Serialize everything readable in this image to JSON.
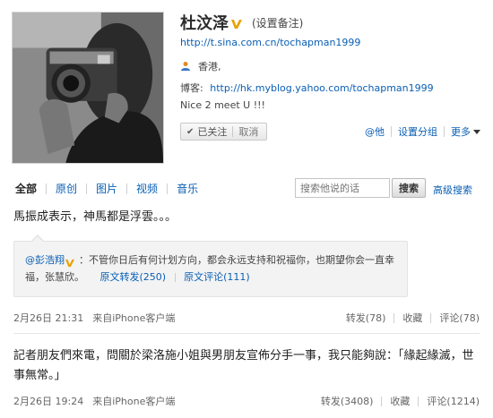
{
  "profile": {
    "name": "杜汶泽",
    "verified_icon": "verified-v-icon",
    "remark_link": "(设置备注)",
    "home_url": "http://t.sina.com.cn/tochapman1999",
    "location_icon": "person-location-icon",
    "location": "香港,",
    "blog_label": "博客:",
    "blog_url": "http://hk.myblog.yahoo.com/tochapman1999",
    "bio": "Nice 2 meet U !!!",
    "follow_status": "已关注",
    "unfollow": "取消",
    "actions": {
      "mention": "@他",
      "set_group": "设置分组",
      "more": "更多"
    }
  },
  "tabs": [
    {
      "label": "全部",
      "active": true
    },
    {
      "label": "原创",
      "active": false
    },
    {
      "label": "图片",
      "active": false
    },
    {
      "label": "视频",
      "active": false
    },
    {
      "label": "音乐",
      "active": false
    }
  ],
  "search": {
    "placeholder": "搜索他说的话",
    "button": "搜索",
    "advanced": "高级搜索"
  },
  "posts": [
    {
      "text": "馬振成表示，神馬都是浮雲。。。",
      "retweet": {
        "author": "@彭浩翔",
        "author_verified_icon": "verified-v-icon",
        "text": "：不管你日后有何计划方向，都会永远支持和祝福你，也期望你会一直幸福，张慧欣。",
        "orig_repost": "原文转发(250)",
        "orig_comment": "原文评论(111)"
      },
      "time": "2月26日 21:31",
      "source": "来自iPhone客户端",
      "repost": "转发(78)",
      "favorite": "收藏",
      "comment": "评论(78)"
    },
    {
      "text": "記者朋友們來電，問關於梁洛施小姐與男朋友宣佈分手一事，我只能夠說：「緣起緣滅，世事無常。」",
      "time": "2月26日 19:24",
      "source": "来自iPhone客户端",
      "repost": "转发(3408)",
      "favorite": "收藏",
      "comment": "评论(1214)"
    }
  ],
  "colors": {
    "link": "#0a5fb4",
    "verified_badge": "#e8a200"
  }
}
